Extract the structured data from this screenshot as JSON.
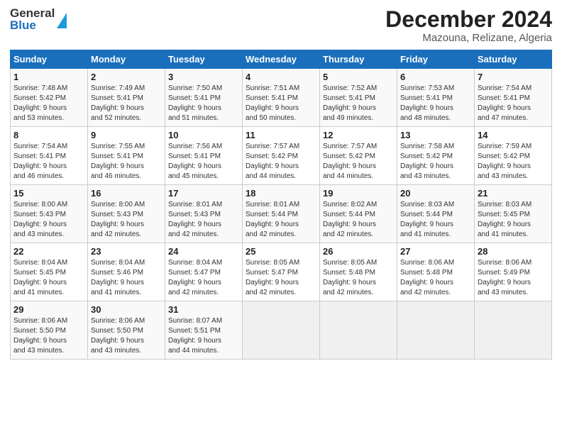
{
  "logo": {
    "general": "General",
    "blue": "Blue"
  },
  "title": "December 2024",
  "subtitle": "Mazouna, Relizane, Algeria",
  "days_header": [
    "Sunday",
    "Monday",
    "Tuesday",
    "Wednesday",
    "Thursday",
    "Friday",
    "Saturday"
  ],
  "weeks": [
    [
      {
        "day": "1",
        "sunrise": "7:48 AM",
        "sunset": "5:42 PM",
        "daylight": "9 hours and 53 minutes."
      },
      {
        "day": "2",
        "sunrise": "7:49 AM",
        "sunset": "5:41 PM",
        "daylight": "9 hours and 52 minutes."
      },
      {
        "day": "3",
        "sunrise": "7:50 AM",
        "sunset": "5:41 PM",
        "daylight": "9 hours and 51 minutes."
      },
      {
        "day": "4",
        "sunrise": "7:51 AM",
        "sunset": "5:41 PM",
        "daylight": "9 hours and 50 minutes."
      },
      {
        "day": "5",
        "sunrise": "7:52 AM",
        "sunset": "5:41 PM",
        "daylight": "9 hours and 49 minutes."
      },
      {
        "day": "6",
        "sunrise": "7:53 AM",
        "sunset": "5:41 PM",
        "daylight": "9 hours and 48 minutes."
      },
      {
        "day": "7",
        "sunrise": "7:54 AM",
        "sunset": "5:41 PM",
        "daylight": "9 hours and 47 minutes."
      }
    ],
    [
      {
        "day": "8",
        "sunrise": "7:54 AM",
        "sunset": "5:41 PM",
        "daylight": "9 hours and 46 minutes."
      },
      {
        "day": "9",
        "sunrise": "7:55 AM",
        "sunset": "5:41 PM",
        "daylight": "9 hours and 46 minutes."
      },
      {
        "day": "10",
        "sunrise": "7:56 AM",
        "sunset": "5:41 PM",
        "daylight": "9 hours and 45 minutes."
      },
      {
        "day": "11",
        "sunrise": "7:57 AM",
        "sunset": "5:42 PM",
        "daylight": "9 hours and 44 minutes."
      },
      {
        "day": "12",
        "sunrise": "7:57 AM",
        "sunset": "5:42 PM",
        "daylight": "9 hours and 44 minutes."
      },
      {
        "day": "13",
        "sunrise": "7:58 AM",
        "sunset": "5:42 PM",
        "daylight": "9 hours and 43 minutes."
      },
      {
        "day": "14",
        "sunrise": "7:59 AM",
        "sunset": "5:42 PM",
        "daylight": "9 hours and 43 minutes."
      }
    ],
    [
      {
        "day": "15",
        "sunrise": "8:00 AM",
        "sunset": "5:43 PM",
        "daylight": "9 hours and 43 minutes."
      },
      {
        "day": "16",
        "sunrise": "8:00 AM",
        "sunset": "5:43 PM",
        "daylight": "9 hours and 42 minutes."
      },
      {
        "day": "17",
        "sunrise": "8:01 AM",
        "sunset": "5:43 PM",
        "daylight": "9 hours and 42 minutes."
      },
      {
        "day": "18",
        "sunrise": "8:01 AM",
        "sunset": "5:44 PM",
        "daylight": "9 hours and 42 minutes."
      },
      {
        "day": "19",
        "sunrise": "8:02 AM",
        "sunset": "5:44 PM",
        "daylight": "9 hours and 42 minutes."
      },
      {
        "day": "20",
        "sunrise": "8:03 AM",
        "sunset": "5:44 PM",
        "daylight": "9 hours and 41 minutes."
      },
      {
        "day": "21",
        "sunrise": "8:03 AM",
        "sunset": "5:45 PM",
        "daylight": "9 hours and 41 minutes."
      }
    ],
    [
      {
        "day": "22",
        "sunrise": "8:04 AM",
        "sunset": "5:45 PM",
        "daylight": "9 hours and 41 minutes."
      },
      {
        "day": "23",
        "sunrise": "8:04 AM",
        "sunset": "5:46 PM",
        "daylight": "9 hours and 41 minutes."
      },
      {
        "day": "24",
        "sunrise": "8:04 AM",
        "sunset": "5:47 PM",
        "daylight": "9 hours and 42 minutes."
      },
      {
        "day": "25",
        "sunrise": "8:05 AM",
        "sunset": "5:47 PM",
        "daylight": "9 hours and 42 minutes."
      },
      {
        "day": "26",
        "sunrise": "8:05 AM",
        "sunset": "5:48 PM",
        "daylight": "9 hours and 42 minutes."
      },
      {
        "day": "27",
        "sunrise": "8:06 AM",
        "sunset": "5:48 PM",
        "daylight": "9 hours and 42 minutes."
      },
      {
        "day": "28",
        "sunrise": "8:06 AM",
        "sunset": "5:49 PM",
        "daylight": "9 hours and 43 minutes."
      }
    ],
    [
      {
        "day": "29",
        "sunrise": "8:06 AM",
        "sunset": "5:50 PM",
        "daylight": "9 hours and 43 minutes."
      },
      {
        "day": "30",
        "sunrise": "8:06 AM",
        "sunset": "5:50 PM",
        "daylight": "9 hours and 43 minutes."
      },
      {
        "day": "31",
        "sunrise": "8:07 AM",
        "sunset": "5:51 PM",
        "daylight": "9 hours and 44 minutes."
      },
      null,
      null,
      null,
      null
    ]
  ],
  "labels": {
    "sunrise": "Sunrise: ",
    "sunset": "Sunset: ",
    "daylight": "Daylight: "
  }
}
